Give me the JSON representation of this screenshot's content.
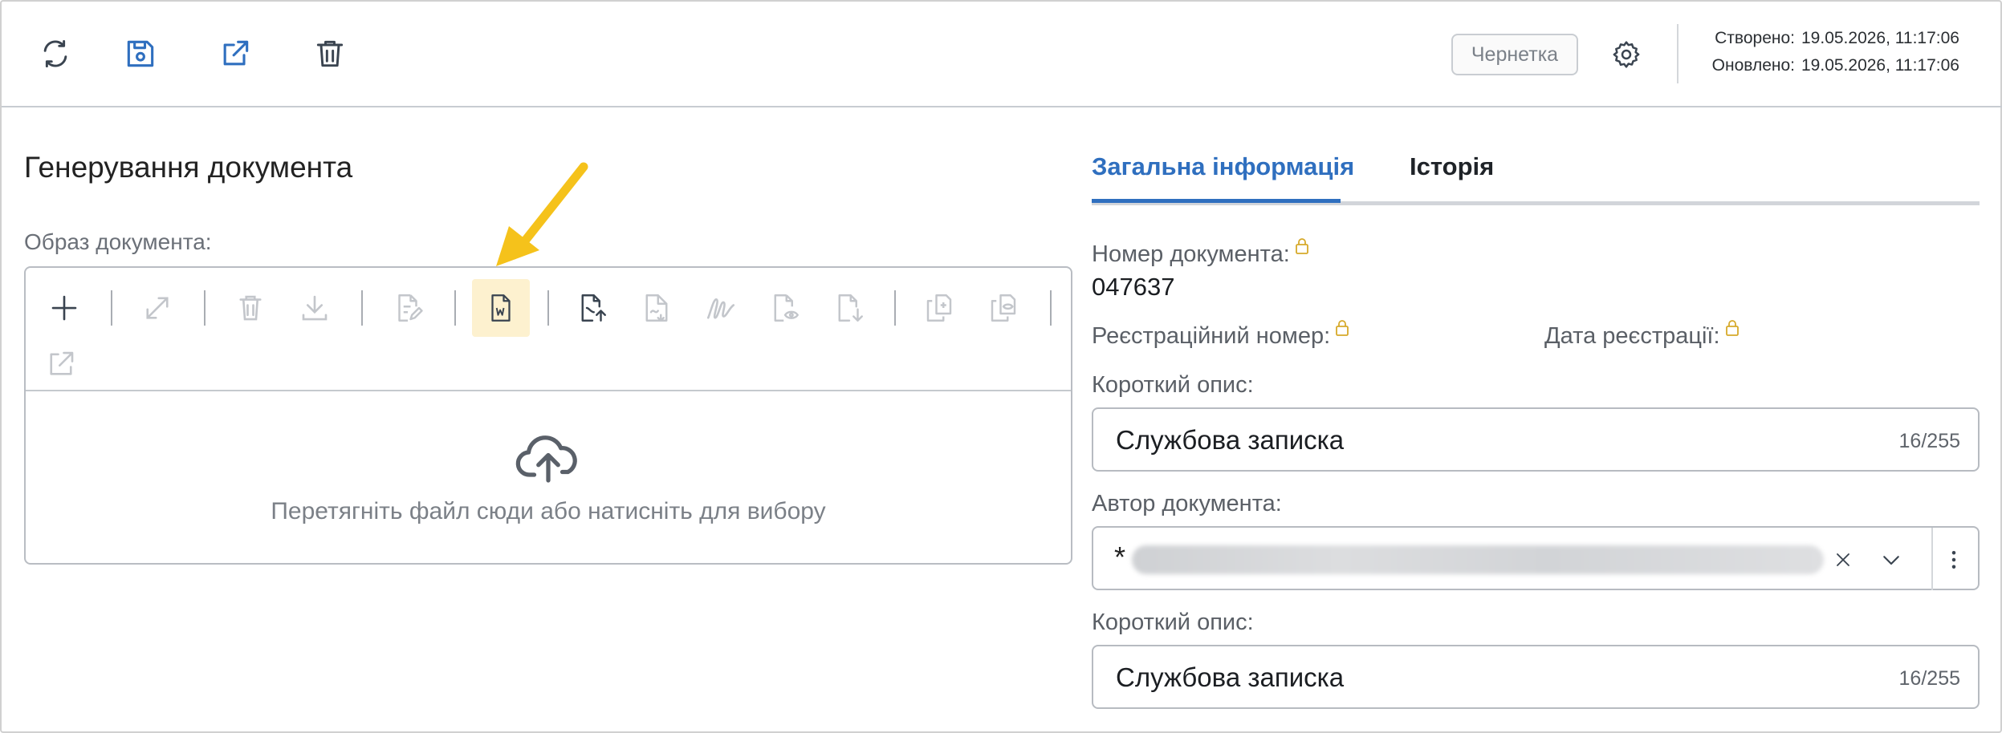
{
  "toolbar": {
    "refresh_icon": "refresh-icon",
    "save_icon": "save-icon",
    "open_external_icon": "external-link-icon",
    "delete_icon": "trash-icon",
    "status_badge": "Чернетка",
    "created_label": "Створено:",
    "created_value": "19.05.2026, 11:17:06",
    "updated_label": "Оновлено:",
    "updated_value": "19.05.2026, 11:17:06"
  },
  "left": {
    "title": "Генерування документа",
    "image_label": "Образ документа:",
    "drop_text": "Перетягніть файл сюди або натисніть для вибору"
  },
  "tabs": [
    {
      "label": "Загальна інформація",
      "active": true
    },
    {
      "label": "Історія",
      "active": false
    }
  ],
  "form": {
    "doc_number_label": "Номер документа:",
    "doc_number_value": "047637",
    "reg_number_label": "Реєстраційний номер:",
    "reg_date_label": "Дата реєстрації:",
    "short_desc_label": "Короткий опис:",
    "short_desc_value": "Службова записка",
    "short_desc_counter": "16/255",
    "author_label": "Автор документа:",
    "author_prefix": "*",
    "short_desc2_label": "Короткий опис:",
    "short_desc2_value": "Службова записка",
    "short_desc2_counter": "16/255"
  },
  "colors": {
    "accent": "#2f6fbf",
    "highlight_bg": "#fdf1cf",
    "arrow": "#f5c21b"
  }
}
